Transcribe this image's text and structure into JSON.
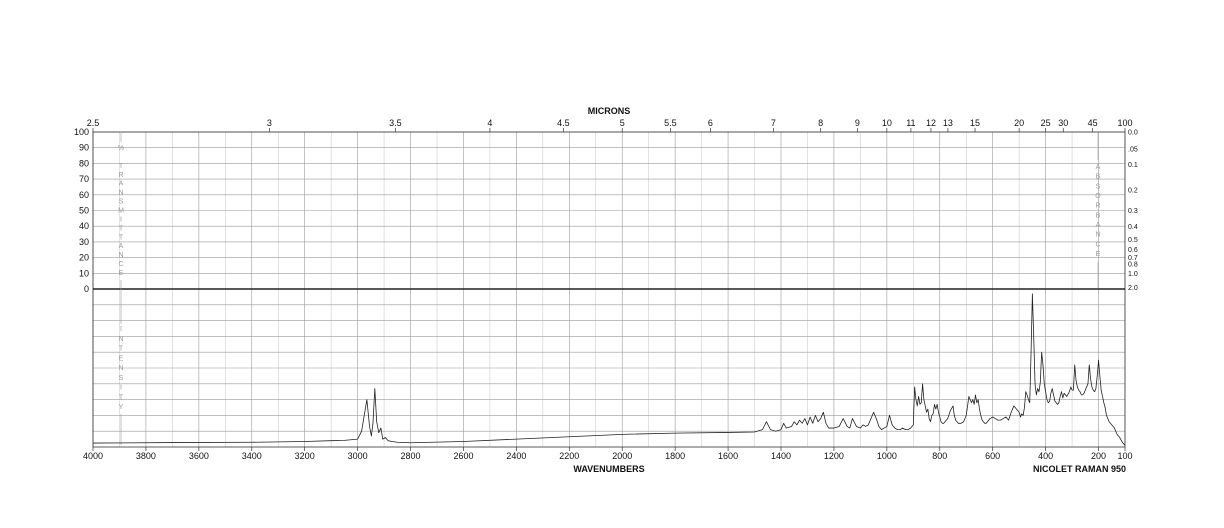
{
  "chart_data": {
    "type": "line",
    "title": "MICRONS",
    "xlabel": "WAVENUMBERS",
    "instrument": "NICOLET RAMAN 950",
    "xlim": [
      4000,
      100
    ],
    "x_ticks": [
      4000,
      3800,
      3600,
      3400,
      3200,
      3000,
      2800,
      2600,
      2400,
      2200,
      2000,
      1800,
      1600,
      1400,
      1200,
      1000,
      800,
      600,
      400,
      200,
      100
    ],
    "micron_ticks": [
      {
        "label": "2.5",
        "value": 2.5
      },
      {
        "label": "3",
        "value": 3
      },
      {
        "label": "3.5",
        "value": 3.5
      },
      {
        "label": "4",
        "value": 4
      },
      {
        "label": "4.5",
        "value": 4.5
      },
      {
        "label": "5",
        "value": 5
      },
      {
        "label": "5.5",
        "value": 5.5
      },
      {
        "label": "6",
        "value": 6
      },
      {
        "label": "7",
        "value": 7
      },
      {
        "label": "8",
        "value": 8
      },
      {
        "label": "9",
        "value": 9
      },
      {
        "label": "10",
        "value": 10
      },
      {
        "label": "11",
        "value": 11
      },
      {
        "label": "12",
        "value": 12
      },
      {
        "label": "13",
        "value": 13
      },
      {
        "label": "15",
        "value": 15
      },
      {
        "label": "20",
        "value": 20
      },
      {
        "label": "25",
        "value": 25
      },
      {
        "label": "30",
        "value": 30
      },
      {
        "label": "45",
        "value": 45
      },
      {
        "label": "100",
        "value": 100
      }
    ],
    "transmittance_ticks": [
      "100",
      "90",
      "80",
      "70",
      "60",
      "50",
      "40",
      "30",
      "20",
      "10",
      "0"
    ],
    "absorbance_ticks": [
      {
        "label": "0.0",
        "value": 0.0
      },
      {
        "label": ".05",
        "value": 0.05
      },
      {
        "label": "0.1",
        "value": 0.1
      },
      {
        "label": "0.2",
        "value": 0.2
      },
      {
        "label": "0.3",
        "value": 0.3
      },
      {
        "label": "0.4",
        "value": 0.4
      },
      {
        "label": "0.5",
        "value": 0.5
      },
      {
        "label": "0.6",
        "value": 0.6
      },
      {
        "label": "0.7",
        "value": 0.7
      },
      {
        "label": "0.8",
        "value": 0.8
      },
      {
        "label": "1.0",
        "value": 1.0
      },
      {
        "label": "2.0",
        "value": 2.0
      }
    ],
    "left_vertical_label": "% TRANSMITTANCE",
    "lower_vertical_label": "INTENSITY",
    "right_vertical_label": "ABSORBANCE",
    "ylim": [
      0,
      100
    ],
    "grid": true,
    "series": [
      {
        "color": "#222222",
        "x": [
          4000,
          3700,
          3400,
          3200,
          3100,
          3050,
          3000,
          2985,
          2975,
          2965,
          2955,
          2948,
          2942,
          2935,
          2928,
          2920,
          2912,
          2905,
          2895,
          2885,
          2870,
          2850,
          2800,
          2600,
          2400,
          2200,
          2000,
          1800,
          1600,
          1500,
          1470,
          1455,
          1440,
          1420,
          1400,
          1390,
          1380,
          1360,
          1350,
          1340,
          1330,
          1320,
          1310,
          1300,
          1290,
          1280,
          1270,
          1260,
          1250,
          1240,
          1230,
          1220,
          1200,
          1180,
          1165,
          1150,
          1140,
          1130,
          1115,
          1100,
          1090,
          1080,
          1070,
          1060,
          1050,
          1040,
          1030,
          1020,
          1010,
          1000,
          990,
          980,
          970,
          960,
          950,
          940,
          930,
          920,
          910,
          900,
          895,
          890,
          885,
          880,
          875,
          870,
          865,
          860,
          855,
          850,
          845,
          840,
          835,
          830,
          825,
          820,
          815,
          810,
          805,
          800,
          795,
          790,
          785,
          780,
          770,
          760,
          750,
          745,
          740,
          735,
          730,
          720,
          710,
          700,
          690,
          680,
          675,
          670,
          665,
          660,
          655,
          650,
          645,
          640,
          635,
          630,
          625,
          620,
          610,
          600,
          590,
          580,
          570,
          560,
          550,
          540,
          530,
          520,
          510,
          500,
          495,
          490,
          485,
          480,
          475,
          470,
          465,
          460,
          455,
          450,
          445,
          440,
          435,
          430,
          425,
          420,
          415,
          410,
          405,
          400,
          395,
          390,
          385,
          380,
          375,
          370,
          365,
          360,
          355,
          350,
          345,
          340,
          335,
          330,
          320,
          310,
          305,
          300,
          295,
          290,
          285,
          280,
          275,
          270,
          265,
          260,
          255,
          250,
          245,
          240,
          235,
          230,
          225,
          220,
          215,
          210,
          205,
          200,
          195,
          190,
          185,
          180,
          175,
          170,
          165,
          160,
          155,
          150,
          140,
          130,
          120,
          110,
          100
        ],
        "y": [
          2.5,
          2.8,
          3.0,
          3.5,
          4.0,
          4.2,
          5.0,
          10,
          20,
          30,
          13,
          7,
          15,
          37,
          16,
          9,
          12,
          5,
          6,
          4,
          3.5,
          3.0,
          2.7,
          3.5,
          5.0,
          6.5,
          8.0,
          8.8,
          9.2,
          9.5,
          11,
          16,
          11,
          10,
          11,
          15,
          12,
          13,
          16,
          14,
          17,
          15,
          18,
          14,
          19,
          15,
          20,
          16,
          18,
          22,
          15,
          12,
          12,
          13,
          18,
          13,
          12,
          18,
          13,
          12,
          14,
          13,
          14,
          18,
          22,
          18,
          13,
          11,
          12,
          13,
          20,
          14,
          12,
          11,
          11,
          12,
          11,
          11,
          12,
          14,
          38,
          30,
          26,
          32,
          27,
          28,
          40,
          30,
          26,
          22,
          24,
          18,
          16,
          20,
          21,
          27,
          24,
          27,
          22,
          19,
          16,
          15,
          15,
          16,
          18,
          23,
          26,
          20,
          17,
          16,
          15,
          15,
          16,
          20,
          32,
          28,
          30,
          27,
          33,
          28,
          30,
          24,
          20,
          17,
          16,
          15,
          15,
          16,
          18,
          19,
          18,
          17,
          17,
          18,
          19,
          17,
          22,
          26,
          24,
          22,
          19,
          21,
          20,
          25,
          35,
          33,
          30,
          28,
          60,
          97,
          70,
          40,
          33,
          37,
          35,
          41,
          60,
          52,
          40,
          35,
          30,
          28,
          29,
          34,
          37,
          33,
          29,
          28,
          27,
          28,
          32,
          35,
          31,
          34,
          32,
          35,
          38,
          36,
          36,
          52,
          42,
          38,
          36,
          35,
          33,
          33,
          34,
          36,
          38,
          40,
          52,
          43,
          38,
          36,
          35,
          37,
          45,
          55,
          45,
          36,
          32,
          28,
          25,
          20,
          18,
          16,
          15,
          14,
          12,
          8,
          6,
          3,
          1
        ]
      }
    ]
  }
}
